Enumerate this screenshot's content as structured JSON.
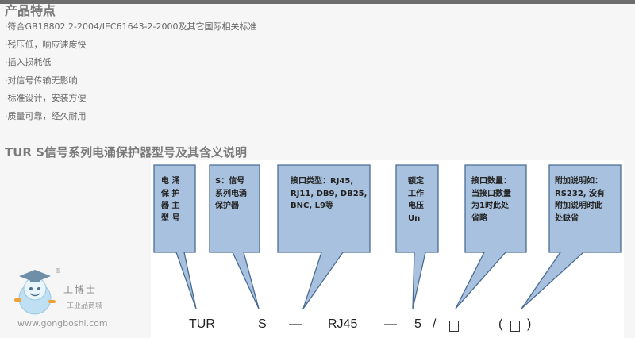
{
  "title": "产品特点",
  "features": [
    "·符合GB18802.2-2004/IEC61643-2-2000及其它国际相关标准",
    "·残压低，响应速度快",
    "·插入损耗低",
    "·对信号传输无影响",
    "·标准设计，安装方便",
    "·质量可靠，经久耐用"
  ],
  "section_title": "TUR S信号系列电涌保护器型号及其含义说明",
  "callouts": [
    [
      "电 涌",
      "保 护",
      "器 主",
      "型 号"
    ],
    [
      "S：信号",
      "系列电涌",
      "保护器"
    ],
    [
      "接口类型：RJ45,",
      "RJ11, DB9, DB25,",
      "BNC, L9等"
    ],
    [
      "额定",
      "工作",
      "电压",
      "Un"
    ],
    [
      "接口数量：",
      "当接口数量",
      "为1时此处",
      "省略"
    ],
    [
      "附加说明如：",
      "RS232, 没有",
      "附加说明时此",
      "处缺省"
    ]
  ],
  "formula": {
    "tur": "TUR",
    "s": "S",
    "dash1": "—",
    "rj45": "RJ45",
    "dash2": "—",
    "five": "5",
    "slash": "/",
    "paren_open": "(",
    "paren_close": ")"
  },
  "logo": {
    "brand": "工博士",
    "subtitle": "工业品商城",
    "url": "www.gongboshi.com",
    "reg": "®"
  },
  "colors": {
    "callout_fill": "#a8c1de",
    "callout_stroke": "#4a6c94",
    "panel": "#ffffff",
    "background": "#f6f6f6"
  }
}
